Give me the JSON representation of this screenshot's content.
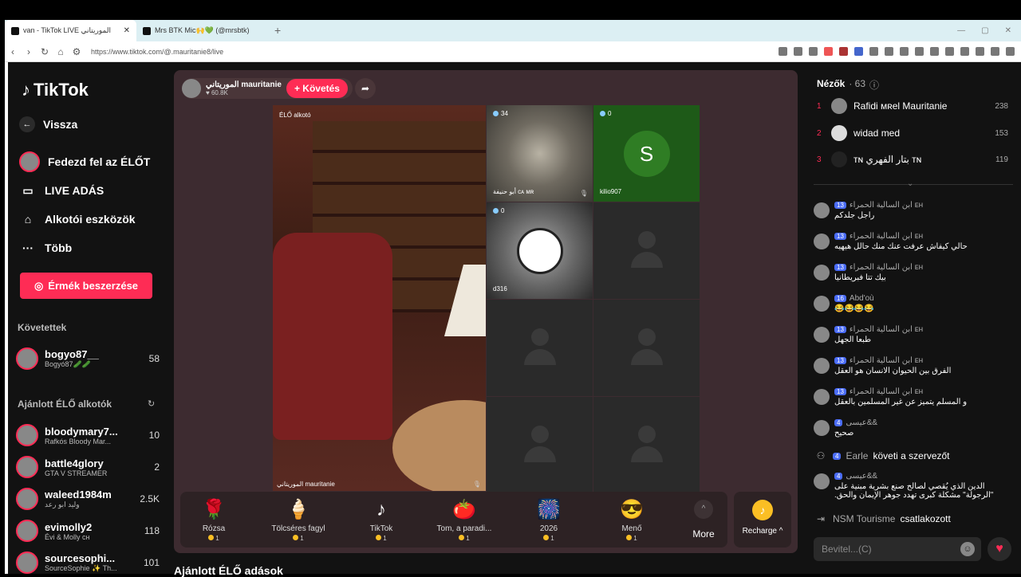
{
  "browser": {
    "tabs": [
      {
        "title": "van - TikTok LIVE الموريتاني"
      },
      {
        "title": "Mrs BTK Mic🙌💚 (@mrsbtk)"
      }
    ],
    "url": "https://www.tiktok.com/@.mauritanie8/live"
  },
  "sidebar": {
    "logo": "TikTok",
    "back": "Vissza",
    "nav": [
      {
        "label": "Fedezd fel az ÉLŐT"
      },
      {
        "label": "LIVE ADÁS"
      },
      {
        "label": "Alkotói eszközök"
      },
      {
        "label": "Több"
      }
    ],
    "coins_button": "Érmék beszerzése",
    "following_title": "Követettek",
    "following": [
      {
        "name": "bogyo87__",
        "sub": "Bogyó87🥒🥒",
        "count": "58"
      }
    ],
    "recommended_title": "Ajánlott ÉLŐ alkotók",
    "recommended": [
      {
        "name": "bloodymary7...",
        "sub": "Rafkós Bloody Mar...",
        "count": "10"
      },
      {
        "name": "battle4glory",
        "sub": "GTA V STREAMER",
        "count": "2"
      },
      {
        "name": "waleed1984m",
        "sub": "وليد ابو رعد",
        "count": "2.5K"
      },
      {
        "name": "evimolly2",
        "sub": "Évi & Molly ᴄʜ",
        "count": "118"
      },
      {
        "name": "sourcesophi...",
        "sub": "SourceSophie ✨ Th...",
        "count": "101"
      }
    ]
  },
  "stream": {
    "host_name": "الموريتاني mauritanie",
    "host_likes": "60.8K",
    "follow_button": "+ Követés",
    "creator_label": "ÉLŐ alkotó",
    "host_caption": "الموريتاني mauritanie",
    "guests": [
      {
        "count": "34",
        "name": "أبو حنيفة ᴄᴀ ᴍʀ"
      },
      {
        "count": "0",
        "name": "kilio907",
        "initial": "S"
      },
      {
        "count": "0",
        "name": "d316"
      }
    ]
  },
  "gifts": [
    {
      "name": "Rózsa",
      "price": "1",
      "icon": "🌹"
    },
    {
      "name": "Tölcséres fagyl",
      "price": "1",
      "icon": "🍦"
    },
    {
      "name": "TikTok",
      "price": "1",
      "icon": "♪"
    },
    {
      "name": "Tom, a paradi...",
      "price": "1",
      "icon": "🍅"
    },
    {
      "name": "2026",
      "price": "1",
      "icon": "🎆"
    },
    {
      "name": "Menő",
      "price": "1",
      "icon": "😎"
    }
  ],
  "gift_more": "More",
  "recharge": "Recharge ^",
  "recommend_title": "Ajánlott ÉLŐ adások",
  "viewers": {
    "title": "Nézők",
    "count": "· 63",
    "list": [
      {
        "rank": "1",
        "name": "Rafidi ᴍʀel Mauritanie",
        "score": "238"
      },
      {
        "rank": "2",
        "name": "widad med",
        "score": "153"
      },
      {
        "rank": "3",
        "name": "ᴛɴ بتار الفهري ᴛɴ",
        "score": "119"
      }
    ]
  },
  "chat": [
    {
      "user": "ابن السالية الحمراء ᴇʜ",
      "level": "13",
      "text": "راجل جلدكم"
    },
    {
      "user": "ابن السالية الحمراء ᴇʜ",
      "level": "13",
      "text": "حالي كيفاش عرفت عنك منك حالل هيهيه"
    },
    {
      "user": "ابن السالية الحمراء ᴇʜ",
      "level": "13",
      "text": "بيك تتا فبريطانيا"
    },
    {
      "user": "Abd'où",
      "level": "16",
      "text": "😂😂😂😂"
    },
    {
      "user": "ابن السالية الحمراء ᴇʜ",
      "level": "13",
      "text": "طبعا الجهل"
    },
    {
      "user": "ابن السالية الحمراء ᴇʜ",
      "level": "13",
      "text": "الفرق بين الحيوان الانسان هو العقل"
    },
    {
      "user": "ابن السالية الحمراء ᴇʜ",
      "level": "13",
      "text": "و المسلم يتميز عن غير المسلمين بالعقل"
    },
    {
      "user": "عيسى&&",
      "level": "4",
      "text": "صحيح"
    }
  ],
  "system1": {
    "user": "Earle",
    "level": "4",
    "text": "követi a szervezőt"
  },
  "chat_last": {
    "user": "عيسى&&",
    "level": "4",
    "text": "الدين الذي يُقصي لصالح صنع بشرية مبنية على \"الرجولة\" مشكلة كبرى تهدد جوهر الإيمان والحق."
  },
  "system2": {
    "user": "NSM Tourisme",
    "text": "csatlakozott"
  },
  "input_placeholder": "Bevitel...(C)"
}
